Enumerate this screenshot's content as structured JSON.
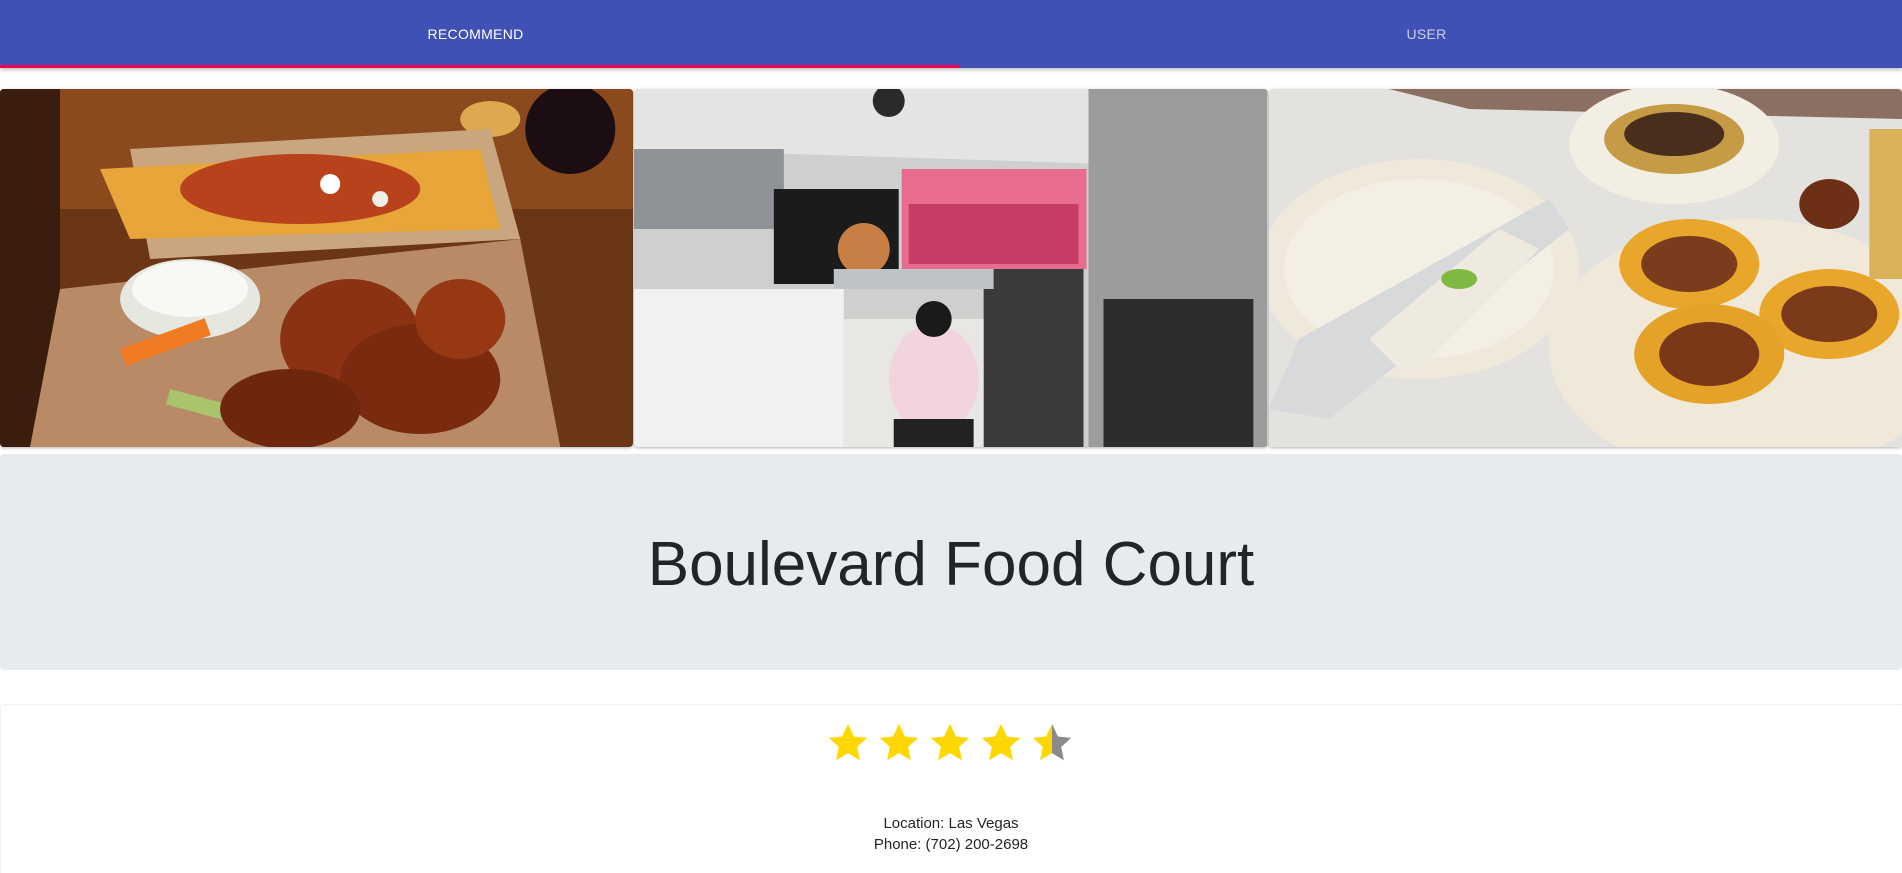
{
  "nav": {
    "tabs": [
      {
        "label": "RECOMMEND",
        "active": true
      },
      {
        "label": "USER",
        "active": false
      }
    ],
    "accent_color": "#3f51b5",
    "indicator_color": "#f50057"
  },
  "gallery": {
    "photos": [
      {
        "icon": "food-photo-wings-fries"
      },
      {
        "icon": "food-photo-pizza-counter"
      },
      {
        "icon": "food-photo-tacos-corn"
      }
    ]
  },
  "restaurant": {
    "name": "Boulevard Food Court",
    "rating": 4.5,
    "rating_max": 5,
    "star_color": "#ffd700",
    "location": "Location: Las Vegas",
    "phone": "Phone: (702) 200-2698"
  }
}
